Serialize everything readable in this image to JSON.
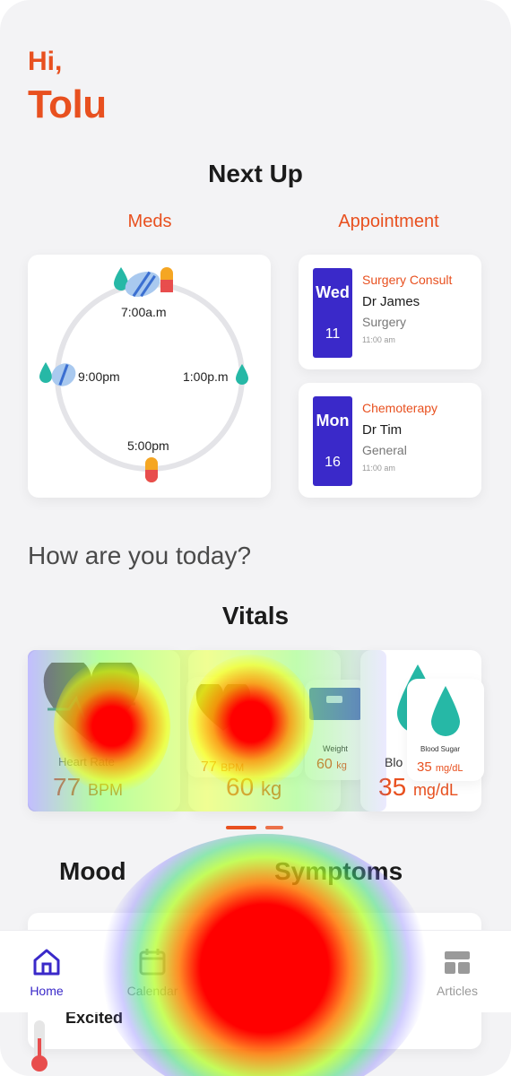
{
  "greeting": {
    "hi": "Hi,",
    "name": "Tolu"
  },
  "next_up": {
    "title": "Next Up",
    "meds_label": "Meds",
    "appointment_label": "Appointment",
    "doses": [
      "7:00a.m",
      "1:00p.m",
      "5:00pm",
      "9:00pm"
    ],
    "appointments": [
      {
        "day": "Wed",
        "date": "11",
        "type": "Surgery Consult",
        "doctor": "Dr James",
        "category": "Surgery",
        "time": "11:00 am"
      },
      {
        "day": "Mon",
        "date": "16",
        "type": "Chemoterapy",
        "doctor": "Dr Tim",
        "category": "General",
        "time": "11:00 am"
      }
    ]
  },
  "question": "How are you today?",
  "vitals": {
    "title": "Vitals",
    "heart_rate": {
      "label": "Heart Rate",
      "value": "77",
      "unit": "BPM"
    },
    "weight": {
      "label": "Weight",
      "value": "60",
      "unit": "kg"
    },
    "blood_sugar": {
      "label": "Blood Sugar",
      "value": "35",
      "unit": "mg/dL"
    },
    "blood_sugar_short": "Blo",
    "overlay_heart": {
      "value": "77",
      "unit": "BPM"
    },
    "overlay_weight": {
      "value": "60",
      "unit": "kg"
    }
  },
  "mood": {
    "title": "Mood",
    "item": "Excited"
  },
  "symptoms": {
    "title": "Symptoms"
  },
  "nav": {
    "home": "Home",
    "calendar": "Calendar",
    "articles": "Articles"
  },
  "colors": {
    "accent": "#e8501f",
    "primary": "#3a29c9",
    "drop": "#26b8a6",
    "pill_orange": "#f5a623",
    "pill_red": "#e84d4d"
  }
}
